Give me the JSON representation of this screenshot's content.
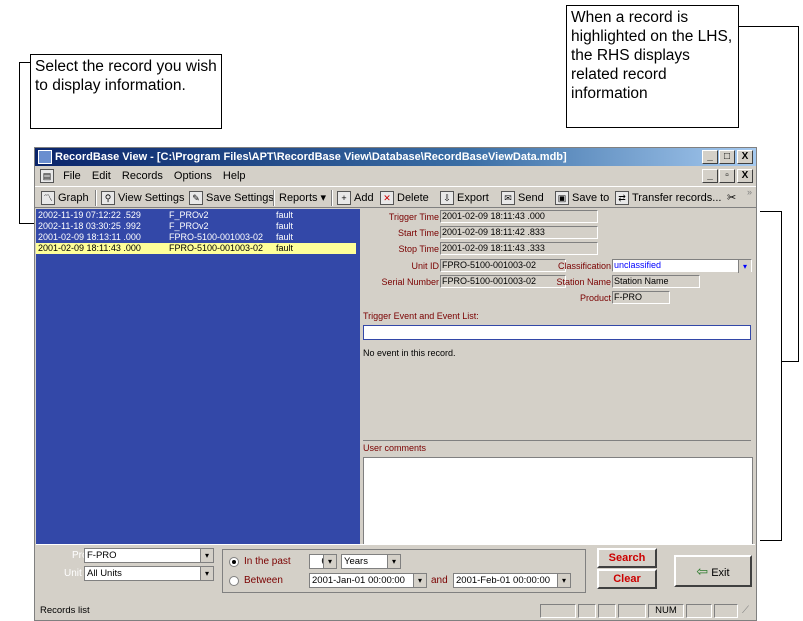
{
  "callouts": {
    "left": "Select the record you wish to display information.",
    "right": "When a record is highlighted on the LHS, the RHS displays related record information"
  },
  "window": {
    "title": "RecordBase View - [C:\\Program Files\\APT\\RecordBase View\\Database\\RecordBaseViewData.mdb]",
    "controls": [
      "_",
      "□",
      "X"
    ],
    "doc_controls": [
      "_",
      "▫",
      "X"
    ]
  },
  "menu": [
    "File",
    "Edit",
    "Records",
    "Options",
    "Help"
  ],
  "toolbar": {
    "graph": "Graph",
    "view_settings": "View Settings",
    "save_settings": "Save Settings",
    "reports": "Reports",
    "add": "Add",
    "delete": "Delete",
    "export": "Export",
    "send": "Send",
    "save_to": "Save to",
    "transfer": "Transfer records...",
    "more": "»"
  },
  "records": [
    {
      "time": "2002-11-19 07:12:22 .529",
      "device": "F_PROv2",
      "type": "fault"
    },
    {
      "time": "2002-11-18 03:30:25 .992",
      "device": "F_PROv2",
      "type": "fault"
    },
    {
      "time": "2001-02-09 18:13:11 .000",
      "device": "FPRO-5100-001003-02",
      "type": "fault"
    },
    {
      "time": "2001-02-09 18:11:43 .000",
      "device": "FPRO-5100-001003-02",
      "type": "fault",
      "selected": true
    }
  ],
  "detail": {
    "trigger_time_label": "Trigger Time",
    "trigger_time": "2001-02-09 18:11:43 .000",
    "start_time_label": "Start Time",
    "start_time": "2001-02-09 18:11:42 .833",
    "stop_time_label": "Stop Time",
    "stop_time": "2001-02-09 18:11:43 .333",
    "unit_id_label": "Unit ID",
    "unit_id": "FPRO-5100-001003-02",
    "serial_label": "Serial Number",
    "serial": "FPRO-5100-001003-02",
    "classification_label": "Classification",
    "classification": "unclassified",
    "station_label": "Station Name",
    "station": "Station Name",
    "product_label": "Product",
    "product": "F-PRO",
    "event_list_label": "Trigger Event and Event List:",
    "no_event": "No event in this record.",
    "comments_label": "User comments"
  },
  "filters": {
    "product_label": "Product:",
    "product_value": "F-PRO",
    "unit_label": "Unit ID:",
    "unit_value": "All Units",
    "past_label": "In the past",
    "past_value": "6",
    "past_unit": "Years",
    "between_label": "Between",
    "from": "2001-Jan-01 00:00:00",
    "and_label": "and",
    "to": "2001-Feb-01 00:00:00",
    "search": "Search",
    "clear": "Clear",
    "exit": "Exit"
  },
  "status": {
    "text": "Records list",
    "num": "NUM"
  },
  "colors": {
    "list_bg": "#3348a8",
    "selected_row": "#ffff99",
    "accent_red": "#cc0000"
  }
}
